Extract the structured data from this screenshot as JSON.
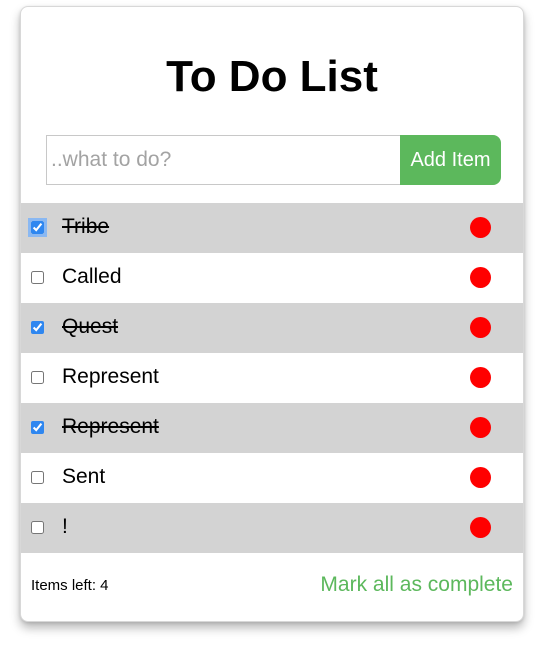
{
  "title": "To Do List",
  "input": {
    "placeholder": "..what to do?",
    "value": ""
  },
  "add_button_label": "Add Item",
  "items": [
    {
      "text": "Tribe",
      "completed": true,
      "focused": true
    },
    {
      "text": "Called",
      "completed": false
    },
    {
      "text": "Quest",
      "completed": true
    },
    {
      "text": "Represent",
      "completed": false
    },
    {
      "text": "Represent",
      "completed": true
    },
    {
      "text": "Sent",
      "completed": false
    },
    {
      "text": "!",
      "completed": false
    }
  ],
  "footer": {
    "items_left": "Items left: 4",
    "mark_all_label": "Mark all as complete"
  },
  "colors": {
    "accent_green": "#5cb85c",
    "delete_red": "#ff0000",
    "stripe_gray": "#d3d3d3",
    "checkbox_blue": "#2f87f0"
  },
  "icons": {
    "delete": "delete-dot-icon"
  }
}
